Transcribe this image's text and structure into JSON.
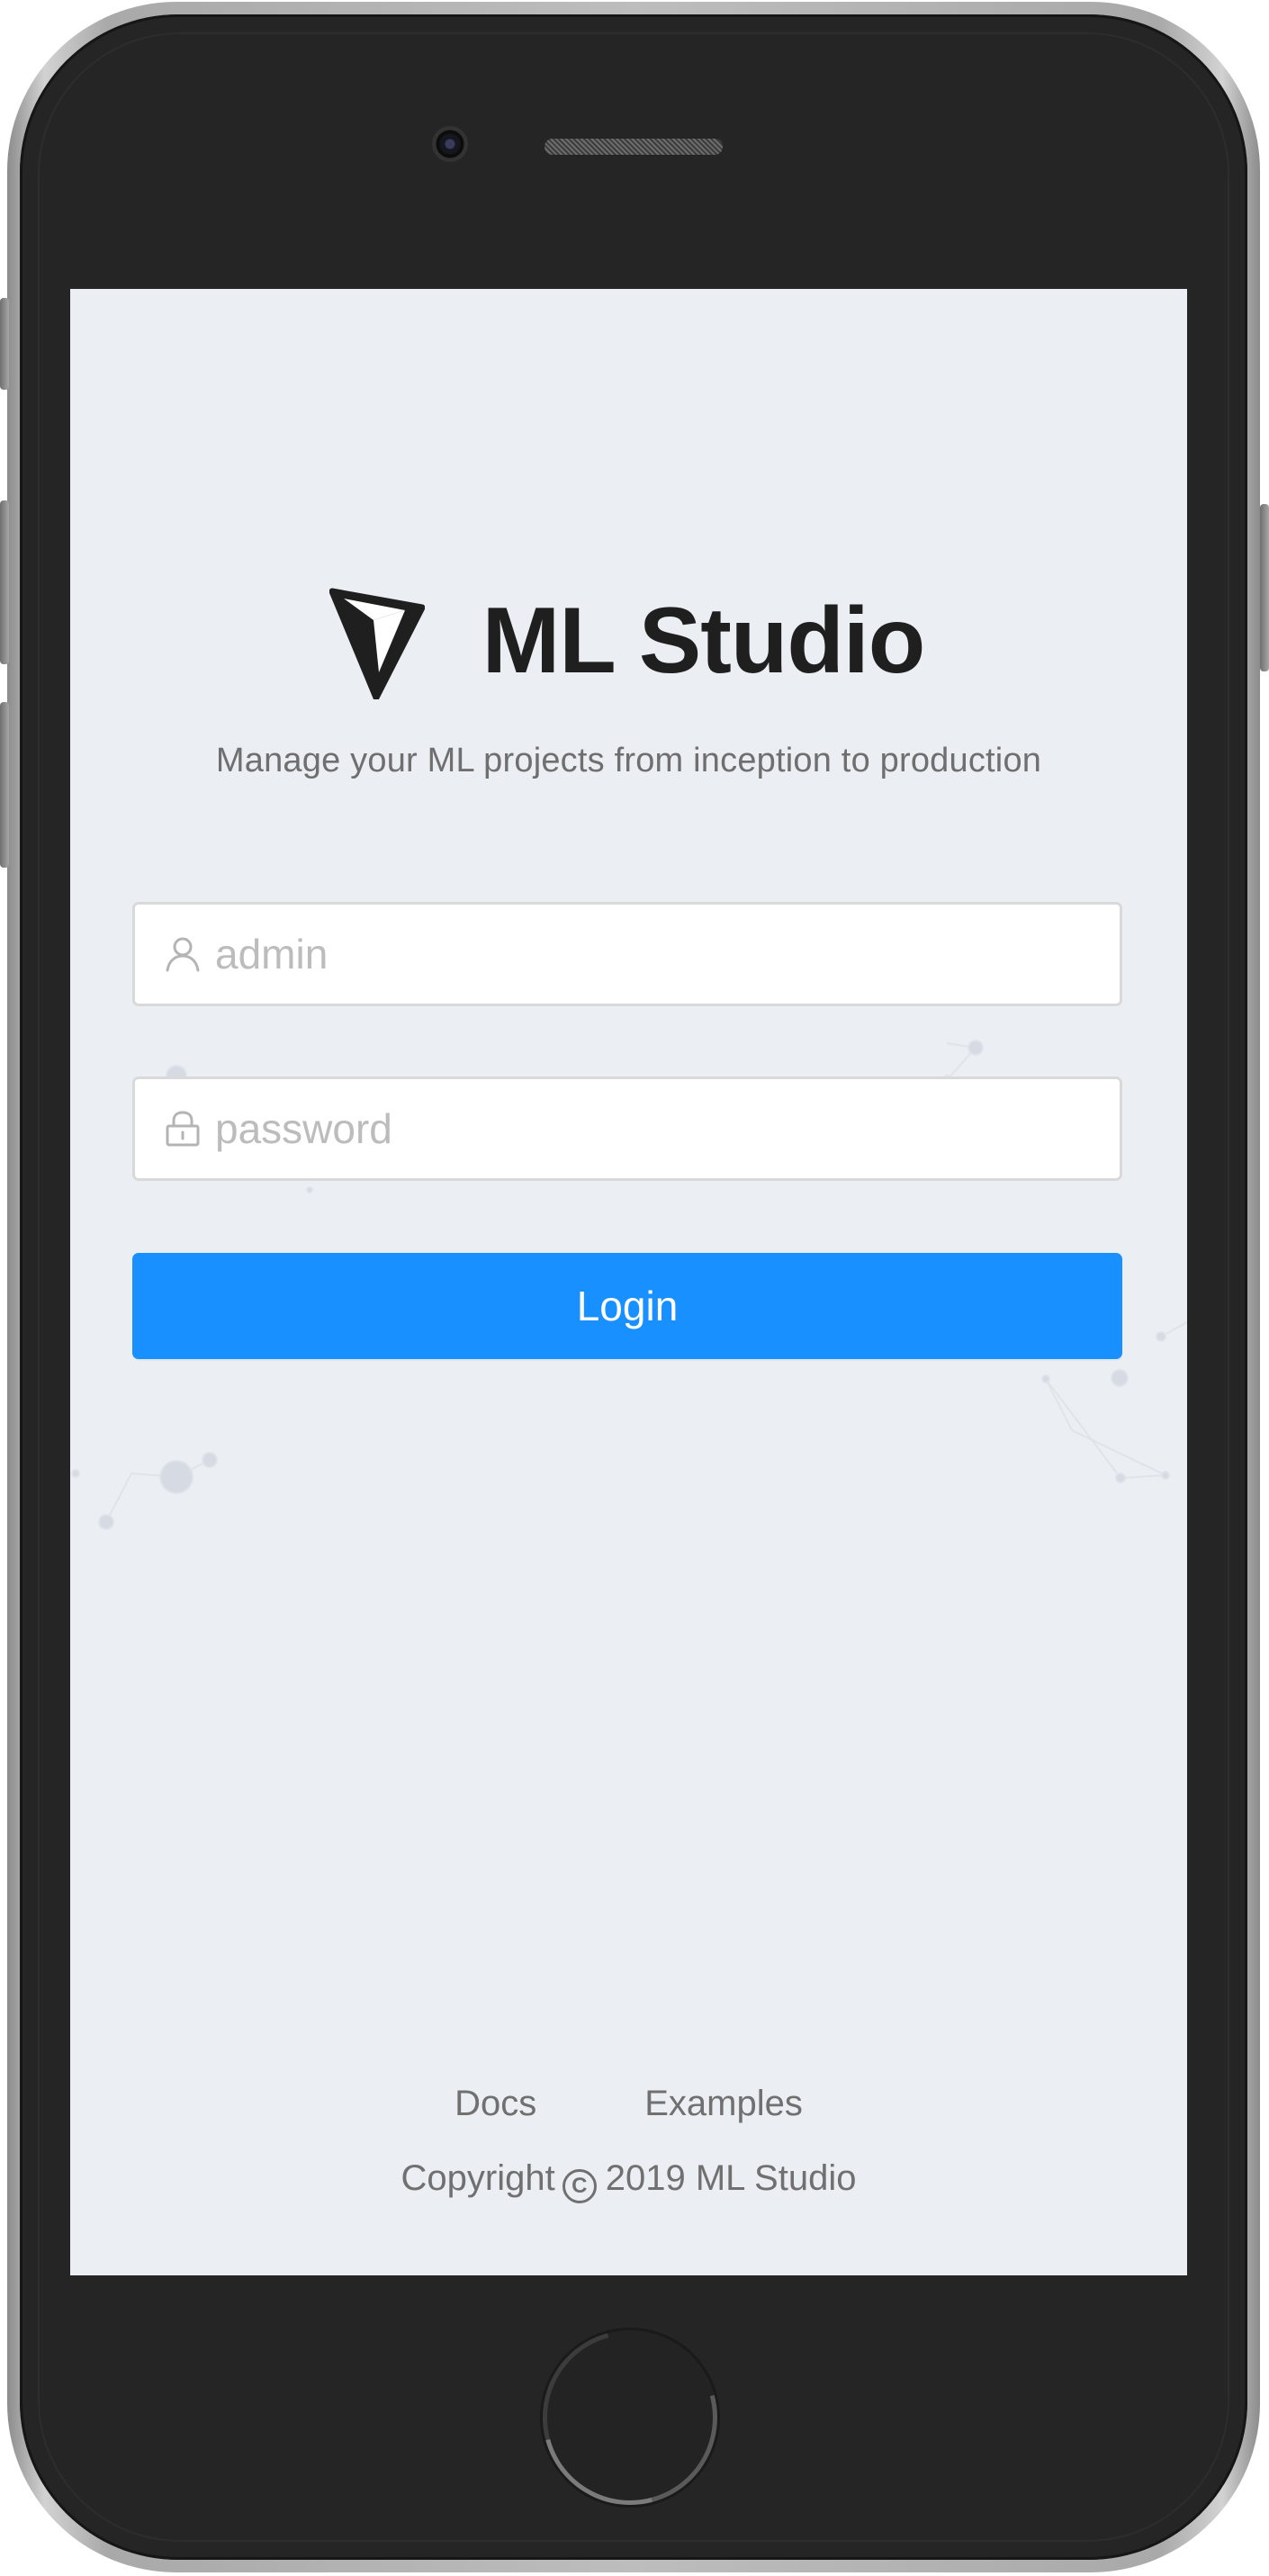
{
  "app": {
    "name": "ML Studio",
    "tagline": "Manage your ML projects from inception to production"
  },
  "form": {
    "username_placeholder": "admin",
    "password_placeholder": "password",
    "login_label": "Login"
  },
  "footer": {
    "links": [
      "Docs",
      "Examples"
    ],
    "copyright_prefix": "Copyright",
    "copyright_suffix": "2019 ML Studio"
  },
  "icons": {
    "logo": "diamond-logo-icon",
    "username": "user-icon",
    "password": "lock-icon",
    "copyright": "copyright-icon"
  },
  "colors": {
    "background": "#ebeef2",
    "primary": "#1890ff",
    "text_muted": "#707070",
    "title": "#1f1f1f"
  }
}
